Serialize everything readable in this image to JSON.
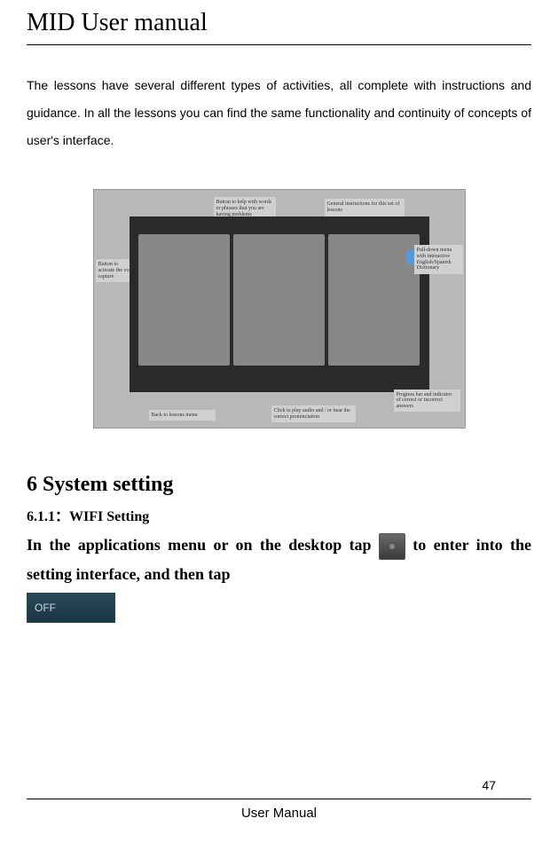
{
  "header": {
    "title": "MID User manual"
  },
  "body": {
    "paragraph1": "The lessons have several different types of activities, all complete with instructions and guidance. In all the lessons you can find the same functionality and continuity of concepts of user's interface."
  },
  "screenshot": {
    "callouts": {
      "top_left": "Button to help with words or phrases that you are having problems",
      "top_right": "General instructions for this set of lessons",
      "left": "Button to activate the voice capture",
      "right": "Pull-down menu with interactive English/Spanish Dictionary",
      "bottom_left": "Back to lessons menu",
      "bottom_mid": "Click to play audio and / or hear the correct pronunciation",
      "bottom_right": "Progress bar and indicator of correct or incorrect answers"
    }
  },
  "section": {
    "heading": "6 System setting",
    "subheading": "6.1.1：WIFI Setting",
    "instruction_part1": "In the applications menu or on the desktop tap",
    "instruction_part2": " to enter into the setting interface, and then tap",
    "off_label": "OFF"
  },
  "footer": {
    "page_number": "47",
    "text": "User Manual"
  }
}
